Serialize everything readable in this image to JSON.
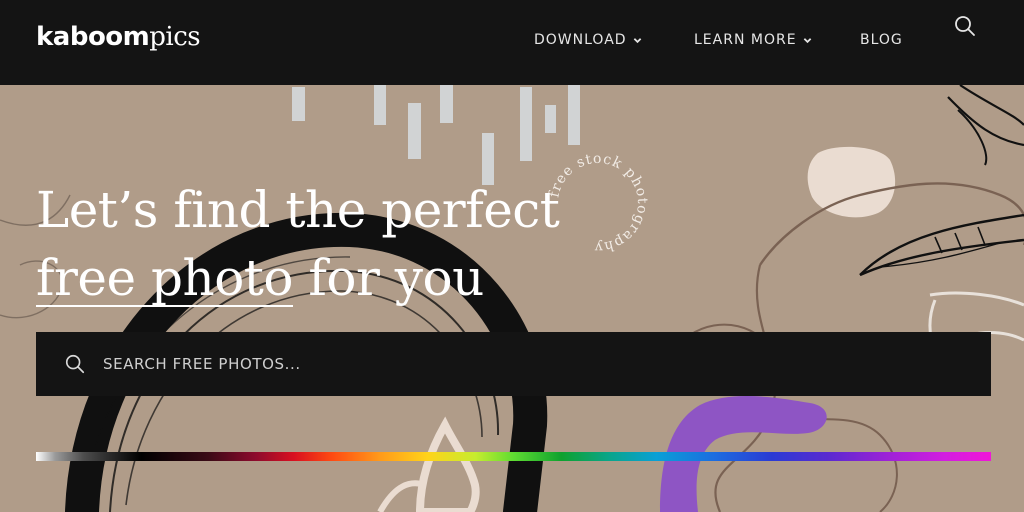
{
  "header": {
    "logo_bold": "kaboom",
    "logo_thin": "pics",
    "nav": [
      {
        "label": "DOWNLOAD",
        "has_dropdown": true
      },
      {
        "label": "LEARN MORE",
        "has_dropdown": true
      },
      {
        "label": "BLOG",
        "has_dropdown": false
      }
    ],
    "search_icon": "search-icon"
  },
  "hero": {
    "line1": "Let’s find the perfect",
    "line2_underlined": "free photo",
    "line2_rest": " for you",
    "badge_text": "free stock photography",
    "search_placeholder": "SEARCH FREE PHOTOS..."
  },
  "colors": {
    "topbar": "#141414",
    "hero_bg": "#b09c89",
    "accent_purple": "#8e55c4",
    "text": "#ffffff"
  }
}
